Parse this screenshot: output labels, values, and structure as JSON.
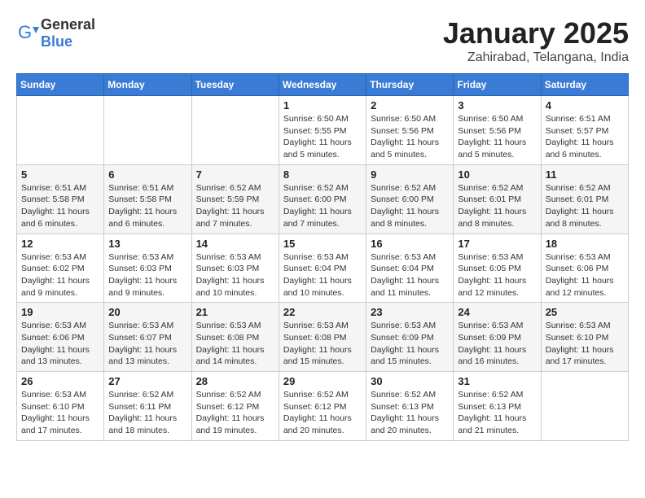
{
  "header": {
    "logo_general": "General",
    "logo_blue": "Blue",
    "month": "January 2025",
    "location": "Zahirabad, Telangana, India"
  },
  "weekdays": [
    "Sunday",
    "Monday",
    "Tuesday",
    "Wednesday",
    "Thursday",
    "Friday",
    "Saturday"
  ],
  "weeks": [
    [
      {
        "day": "",
        "info": ""
      },
      {
        "day": "",
        "info": ""
      },
      {
        "day": "",
        "info": ""
      },
      {
        "day": "1",
        "info": "Sunrise: 6:50 AM\nSunset: 5:55 PM\nDaylight: 11 hours\nand 5 minutes."
      },
      {
        "day": "2",
        "info": "Sunrise: 6:50 AM\nSunset: 5:56 PM\nDaylight: 11 hours\nand 5 minutes."
      },
      {
        "day": "3",
        "info": "Sunrise: 6:50 AM\nSunset: 5:56 PM\nDaylight: 11 hours\nand 5 minutes."
      },
      {
        "day": "4",
        "info": "Sunrise: 6:51 AM\nSunset: 5:57 PM\nDaylight: 11 hours\nand 6 minutes."
      }
    ],
    [
      {
        "day": "5",
        "info": "Sunrise: 6:51 AM\nSunset: 5:58 PM\nDaylight: 11 hours\nand 6 minutes."
      },
      {
        "day": "6",
        "info": "Sunrise: 6:51 AM\nSunset: 5:58 PM\nDaylight: 11 hours\nand 6 minutes."
      },
      {
        "day": "7",
        "info": "Sunrise: 6:52 AM\nSunset: 5:59 PM\nDaylight: 11 hours\nand 7 minutes."
      },
      {
        "day": "8",
        "info": "Sunrise: 6:52 AM\nSunset: 6:00 PM\nDaylight: 11 hours\nand 7 minutes."
      },
      {
        "day": "9",
        "info": "Sunrise: 6:52 AM\nSunset: 6:00 PM\nDaylight: 11 hours\nand 8 minutes."
      },
      {
        "day": "10",
        "info": "Sunrise: 6:52 AM\nSunset: 6:01 PM\nDaylight: 11 hours\nand 8 minutes."
      },
      {
        "day": "11",
        "info": "Sunrise: 6:52 AM\nSunset: 6:01 PM\nDaylight: 11 hours\nand 8 minutes."
      }
    ],
    [
      {
        "day": "12",
        "info": "Sunrise: 6:53 AM\nSunset: 6:02 PM\nDaylight: 11 hours\nand 9 minutes."
      },
      {
        "day": "13",
        "info": "Sunrise: 6:53 AM\nSunset: 6:03 PM\nDaylight: 11 hours\nand 9 minutes."
      },
      {
        "day": "14",
        "info": "Sunrise: 6:53 AM\nSunset: 6:03 PM\nDaylight: 11 hours\nand 10 minutes."
      },
      {
        "day": "15",
        "info": "Sunrise: 6:53 AM\nSunset: 6:04 PM\nDaylight: 11 hours\nand 10 minutes."
      },
      {
        "day": "16",
        "info": "Sunrise: 6:53 AM\nSunset: 6:04 PM\nDaylight: 11 hours\nand 11 minutes."
      },
      {
        "day": "17",
        "info": "Sunrise: 6:53 AM\nSunset: 6:05 PM\nDaylight: 11 hours\nand 12 minutes."
      },
      {
        "day": "18",
        "info": "Sunrise: 6:53 AM\nSunset: 6:06 PM\nDaylight: 11 hours\nand 12 minutes."
      }
    ],
    [
      {
        "day": "19",
        "info": "Sunrise: 6:53 AM\nSunset: 6:06 PM\nDaylight: 11 hours\nand 13 minutes."
      },
      {
        "day": "20",
        "info": "Sunrise: 6:53 AM\nSunset: 6:07 PM\nDaylight: 11 hours\nand 13 minutes."
      },
      {
        "day": "21",
        "info": "Sunrise: 6:53 AM\nSunset: 6:08 PM\nDaylight: 11 hours\nand 14 minutes."
      },
      {
        "day": "22",
        "info": "Sunrise: 6:53 AM\nSunset: 6:08 PM\nDaylight: 11 hours\nand 15 minutes."
      },
      {
        "day": "23",
        "info": "Sunrise: 6:53 AM\nSunset: 6:09 PM\nDaylight: 11 hours\nand 15 minutes."
      },
      {
        "day": "24",
        "info": "Sunrise: 6:53 AM\nSunset: 6:09 PM\nDaylight: 11 hours\nand 16 minutes."
      },
      {
        "day": "25",
        "info": "Sunrise: 6:53 AM\nSunset: 6:10 PM\nDaylight: 11 hours\nand 17 minutes."
      }
    ],
    [
      {
        "day": "26",
        "info": "Sunrise: 6:53 AM\nSunset: 6:10 PM\nDaylight: 11 hours\nand 17 minutes."
      },
      {
        "day": "27",
        "info": "Sunrise: 6:52 AM\nSunset: 6:11 PM\nDaylight: 11 hours\nand 18 minutes."
      },
      {
        "day": "28",
        "info": "Sunrise: 6:52 AM\nSunset: 6:12 PM\nDaylight: 11 hours\nand 19 minutes."
      },
      {
        "day": "29",
        "info": "Sunrise: 6:52 AM\nSunset: 6:12 PM\nDaylight: 11 hours\nand 20 minutes."
      },
      {
        "day": "30",
        "info": "Sunrise: 6:52 AM\nSunset: 6:13 PM\nDaylight: 11 hours\nand 20 minutes."
      },
      {
        "day": "31",
        "info": "Sunrise: 6:52 AM\nSunset: 6:13 PM\nDaylight: 11 hours\nand 21 minutes."
      },
      {
        "day": "",
        "info": ""
      }
    ]
  ]
}
